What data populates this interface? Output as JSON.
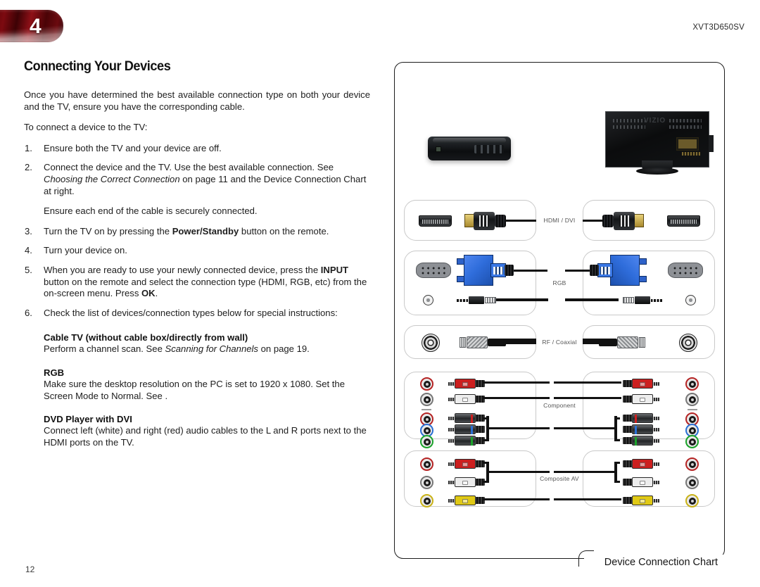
{
  "header": {
    "chapter_number": "4",
    "model_number": "XVT3D650SV",
    "badge_color": "#7d0a10"
  },
  "page": {
    "heading": "Connecting Your Devices",
    "page_number": "12"
  },
  "intro": {
    "paragraph_1": "Once you have determined the best available connection type on both your device and the TV, ensure you have the corresponding cable.",
    "paragraph_2": "To connect a device to the TV:"
  },
  "steps": [
    {
      "number": "1.",
      "text": "Ensure both the TV and your device are off."
    },
    {
      "number": "2.",
      "text_before": "Connect the device and the TV. Use the best available connection. See ",
      "italic": "Choosing the Correct Connection",
      "text_after": " on page 11 and the Device Connection Chart at right."
    },
    {
      "number": "3.",
      "text_before": "Turn the TV on by pressing the ",
      "bold": "Power/Standby",
      "text_after": " button on the remote."
    },
    {
      "number": "4.",
      "text": "Turn your device on."
    },
    {
      "number": "5.",
      "text_before": "When you are ready to use your newly connected device, press the ",
      "bold": "INPUT",
      "text_mid": " button on the remote and select the connection type (HDMI, RGB, etc) from the on-screen menu. Press ",
      "bold2": "OK",
      "text_after": "."
    },
    {
      "number": "6.",
      "text": "Check the list of devices/connection types below for special instructions:"
    }
  ],
  "step_note": "Ensure each end of the cable is securely connected.",
  "subsections": [
    {
      "title": "Cable TV (without cable box/directly from wall)",
      "text_before": "Perform a channel scan. See ",
      "italic": "Scanning for Channels",
      "text_after": " on page 19."
    },
    {
      "title": "RGB",
      "text": "Make sure the desktop resolution on the PC is set to 1920 x 1080. Set the Screen Mode to Normal. See ."
    },
    {
      "title": "DVD Player with DVI",
      "text": "Connect left (white) and right (red) audio cables to the L and R ports next to the HDMI ports on the TV."
    }
  ],
  "chart": {
    "caption": "Device Connection Chart",
    "device_label": "set-top-box",
    "tv_label": "VIZIO",
    "rows": [
      {
        "label": "HDMI / DVI"
      },
      {
        "label": "RGB"
      },
      {
        "label": "RF / Coaxial"
      },
      {
        "label": "Component"
      },
      {
        "label": "Composite AV"
      }
    ],
    "connector_colors": {
      "component": [
        "#cc1f1f",
        "#e8e8e8",
        "#cc1f1f",
        "#2a6fd4",
        "#1aa32a"
      ],
      "composite": [
        "#cc1f1f",
        "#e8e8e8",
        "#e0c915"
      ],
      "vga": "#2f6ddb",
      "hdmi_gold": "#d4b85f"
    }
  }
}
